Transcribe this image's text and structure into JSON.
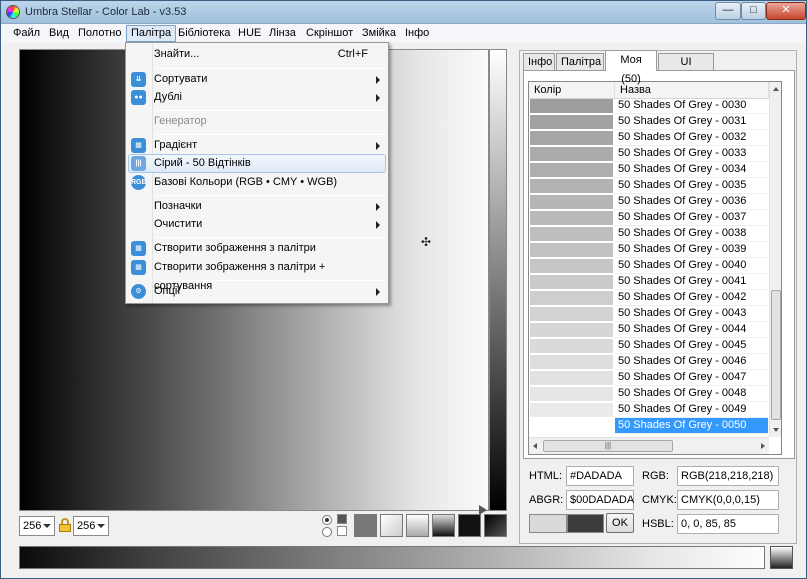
{
  "window": {
    "title": "Umbra Stellar - Color Lab - v3.53"
  },
  "menubar": [
    "Файл",
    "Вид",
    "Полотно",
    "Палітра",
    "Бібліотека",
    "HUE",
    "Лінза",
    "Скріншот",
    "Змійка",
    "Інфо"
  ],
  "dropdown": {
    "find": "Знайти...",
    "find_shortcut": "Ctrl+F",
    "sort": "Сортувати",
    "duplicates": "Дублі",
    "generator": "Генератор",
    "gradient": "Градієнт",
    "greys": "Сірий - 50 Відтінків",
    "base_colors": "Базові Кольори (RGB • CMY • WGB)",
    "marks": "Позначки",
    "clear": "Очистити",
    "create_image": "Створити зображення з палітри",
    "create_image_sorted": "Створити зображення з палітри + сортування",
    "options": "Опції"
  },
  "tabs": [
    "Інфо",
    "Палітра",
    "Моя (50)",
    "UI Дизайн"
  ],
  "list": {
    "col_color": "Колір",
    "col_name": "Назва",
    "rows": [
      {
        "name": "50 Shades Of Grey - 0030",
        "color": "#9e9e9e"
      },
      {
        "name": "50 Shades Of Grey - 0031",
        "color": "#a2a2a2"
      },
      {
        "name": "50 Shades Of Grey - 0032",
        "color": "#a6a6a6"
      },
      {
        "name": "50 Shades Of Grey - 0033",
        "color": "#aaaaaa"
      },
      {
        "name": "50 Shades Of Grey - 0034",
        "color": "#aeaeae"
      },
      {
        "name": "50 Shades Of Grey - 0035",
        "color": "#b2b2b2"
      },
      {
        "name": "50 Shades Of Grey - 0036",
        "color": "#b6b6b6"
      },
      {
        "name": "50 Shades Of Grey - 0037",
        "color": "#bababa"
      },
      {
        "name": "50 Shades Of Grey - 0038",
        "color": "#bebebe"
      },
      {
        "name": "50 Shades Of Grey - 0039",
        "color": "#c2c2c2"
      },
      {
        "name": "50 Shades Of Grey - 0040",
        "color": "#c6c6c6"
      },
      {
        "name": "50 Shades Of Grey - 0041",
        "color": "#cacaca"
      },
      {
        "name": "50 Shades Of Grey - 0042",
        "color": "#cecece"
      },
      {
        "name": "50 Shades Of Grey - 0043",
        "color": "#d2d2d2"
      },
      {
        "name": "50 Shades Of Grey - 0044",
        "color": "#d6d6d6"
      },
      {
        "name": "50 Shades Of Grey - 0045",
        "color": "#dadada"
      },
      {
        "name": "50 Shades Of Grey - 0046",
        "color": "#dedede"
      },
      {
        "name": "50 Shades Of Grey - 0047",
        "color": "#e2e2e2"
      },
      {
        "name": "50 Shades Of Grey - 0048",
        "color": "#e6e6e6"
      },
      {
        "name": "50 Shades Of Grey - 0049",
        "color": "#eaeaea"
      },
      {
        "name": "50 Shades Of Grey - 0050",
        "color": "#ffffff"
      }
    ]
  },
  "info": {
    "html_label": "HTML:",
    "html_value": "#DADADA",
    "rgb_label": "RGB:",
    "rgb_value": "RGB(218,218,218)",
    "abgr_label": "ABGR:",
    "abgr_value": "$00DADADA",
    "cmyk_label": "CMYK:",
    "cmyk_value": "CMYK(0,0,0,15)",
    "hsbl_label": "HSBL:",
    "hsbl_value": "0, 0, 85, 85",
    "ok": "OK",
    "preview_light": "#dadada",
    "preview_dark": "#3c3c3c"
  },
  "canvas_size": {
    "width": "256",
    "height": "256"
  }
}
